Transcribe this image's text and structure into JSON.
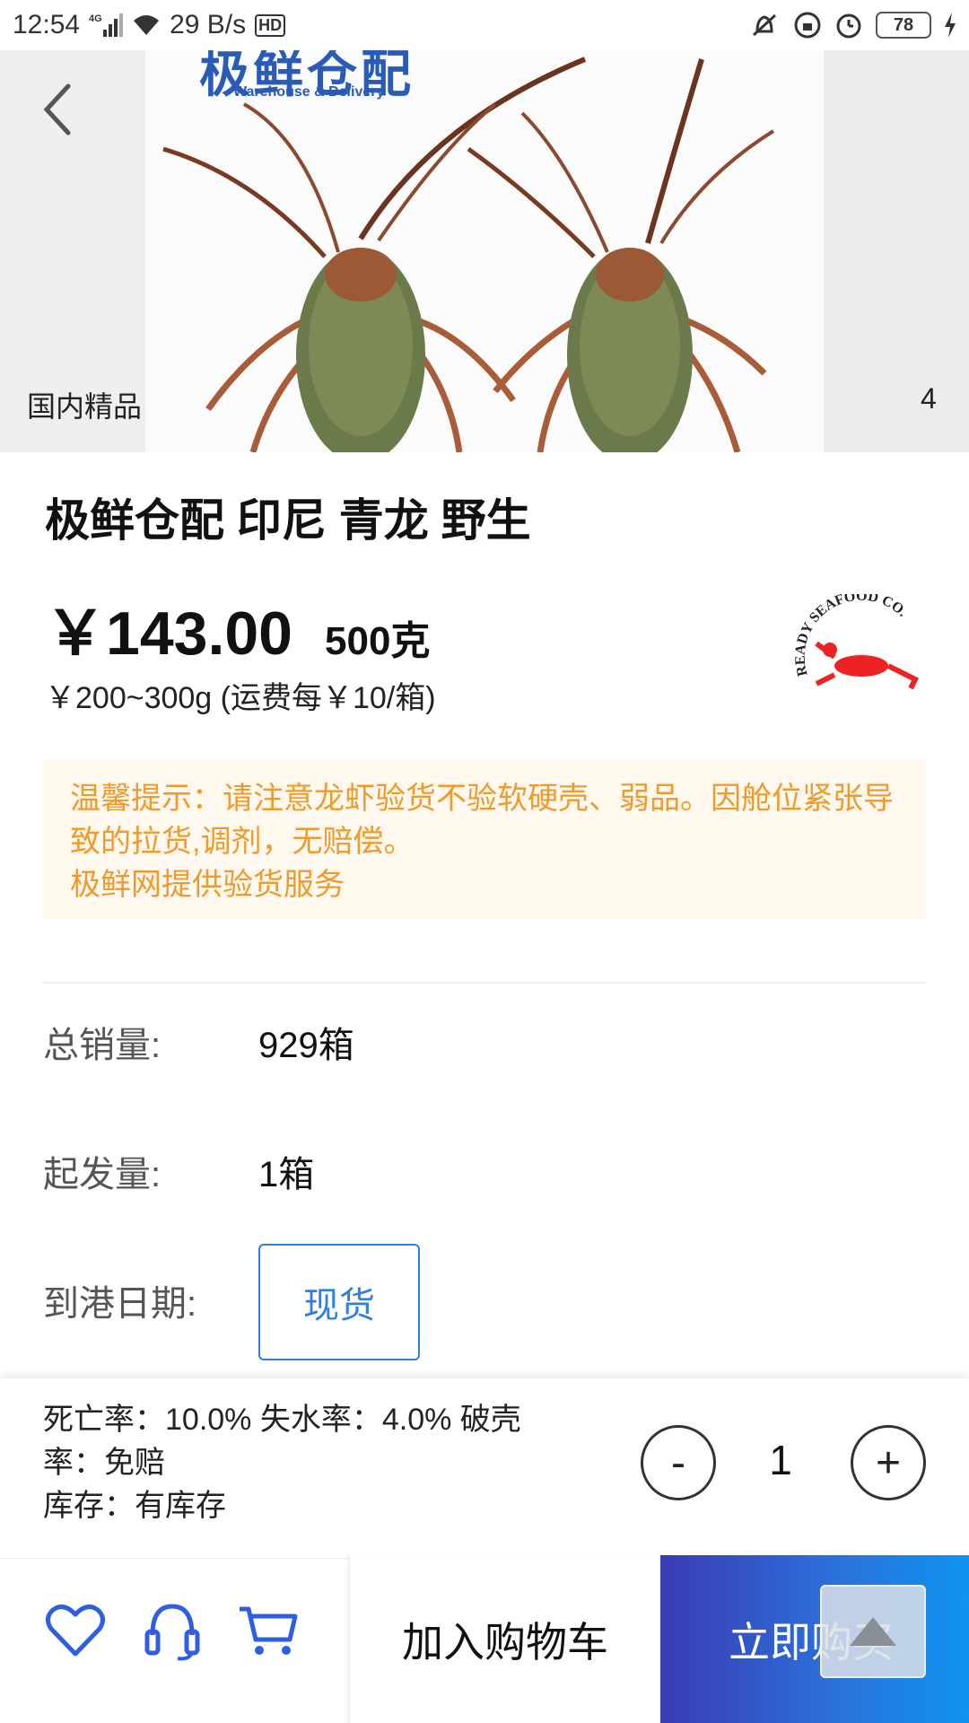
{
  "status_bar": {
    "time": "12:54",
    "network": "4G",
    "speed": "29 B/s",
    "hd": "HD",
    "battery": "78"
  },
  "hero": {
    "brand_text": "极鲜仓配",
    "brand_sub": "Warehouse & Delivery",
    "tag": "国内精品",
    "image_count": "4"
  },
  "product": {
    "title": "极鲜仓配 印尼 青龙 野生",
    "price": "￥143.00",
    "unit": "500克",
    "spec": "￥200~300g (运费每￥10/箱)",
    "logo_text": "READY SEAFOOD CO."
  },
  "notice": {
    "line1": "温馨提示：请注意龙虾验货不验软硬壳、弱品。因舱位紧张导致的拉货,调剂，无赔偿。",
    "line2": "极鲜网提供验货服务"
  },
  "info": {
    "sales_label": "总销量:",
    "sales_value": "929箱",
    "min_label": "起发量:",
    "min_value": "1箱",
    "date_label": "到港日期:",
    "date_option": "现货"
  },
  "bottom_info": {
    "rates": "死亡率：10.0%   失水率：4.0%   破壳率：免赔",
    "stock": "库存：有库存",
    "minus": "-",
    "qty": "1",
    "plus": "+"
  },
  "actions": {
    "add_to_cart": "加入购物车",
    "buy_now": "立即购买"
  },
  "colors": {
    "accent_blue": "#2f7fe4",
    "notice_orange": "#f09a2b",
    "notice_bg": "#fff8ef"
  }
}
